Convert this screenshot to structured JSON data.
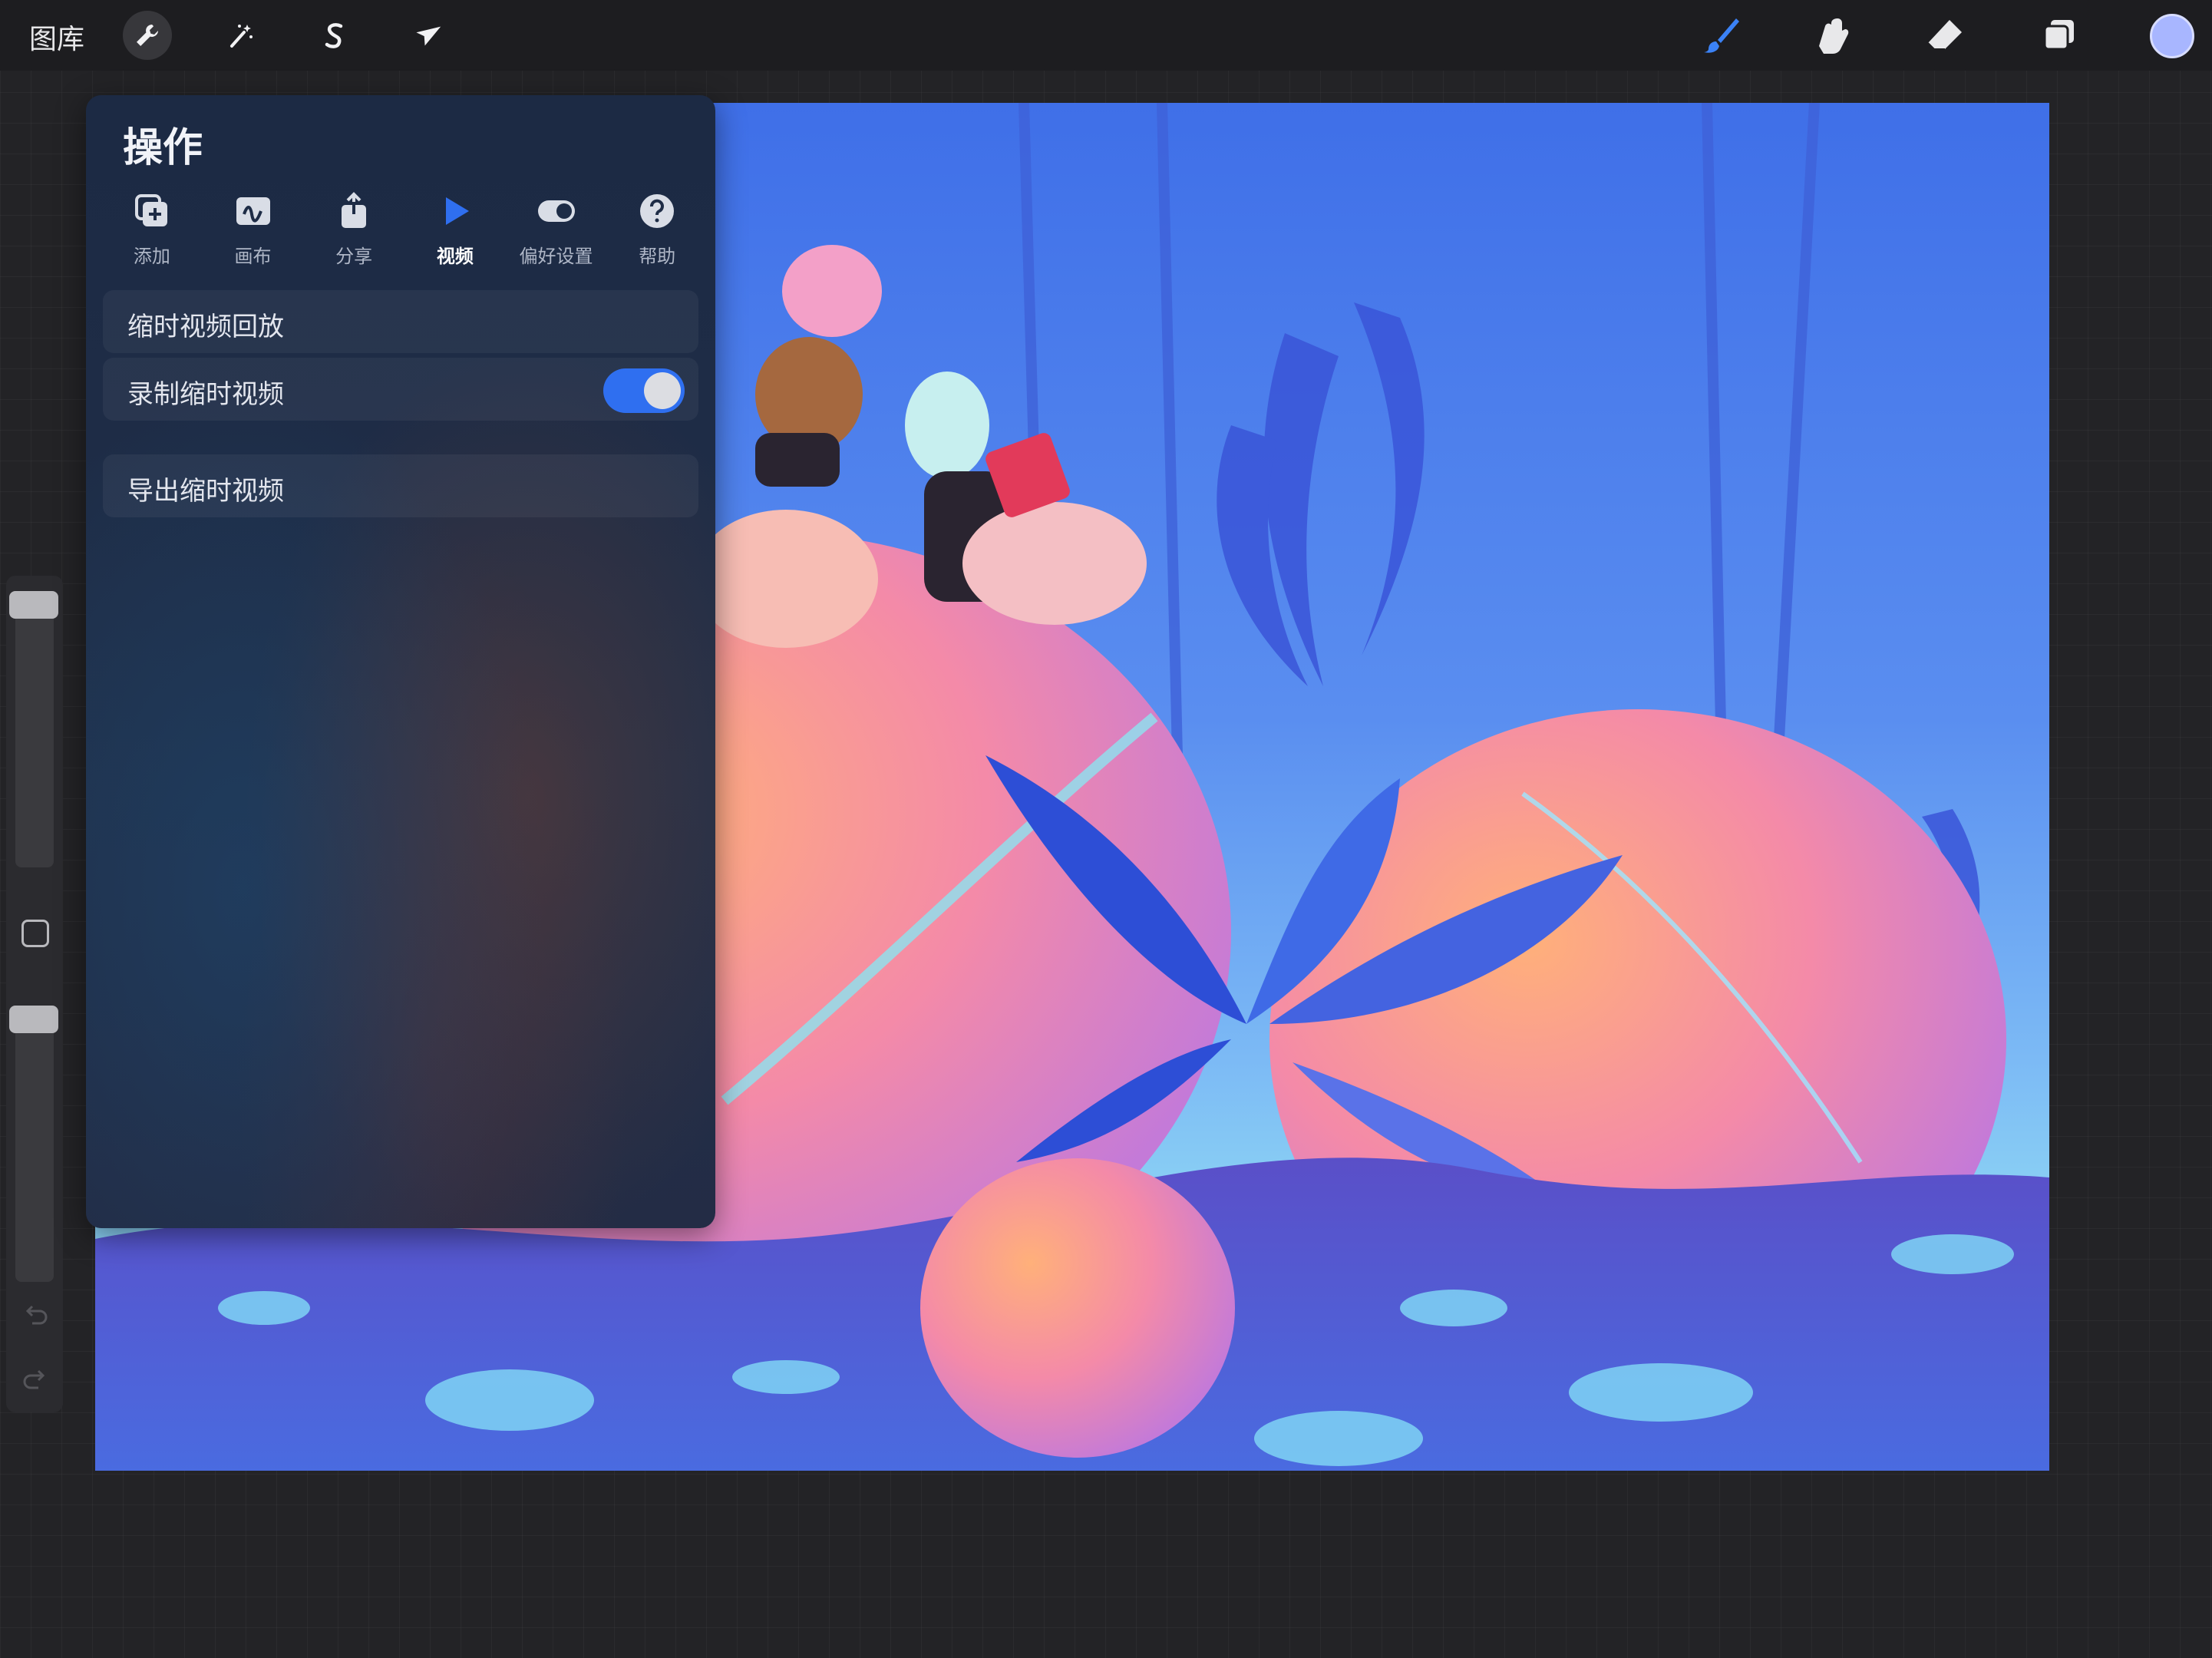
{
  "toolbar": {
    "gallery_label": "图库",
    "left_tools": [
      {
        "name": "actions",
        "icon": "wrench-icon",
        "active": true
      },
      {
        "name": "adjustments",
        "icon": "magic-wand-icon",
        "active": false
      },
      {
        "name": "selection",
        "icon": "selection-s-icon",
        "active": false
      },
      {
        "name": "transform",
        "icon": "arrow-cursor-icon",
        "active": false
      }
    ],
    "right_tools": [
      {
        "name": "brush",
        "icon": "brush-icon",
        "color": "#3b82f6"
      },
      {
        "name": "smudge",
        "icon": "smudge-finger-icon"
      },
      {
        "name": "eraser",
        "icon": "eraser-icon"
      },
      {
        "name": "layers",
        "icon": "layers-icon"
      }
    ],
    "current_color": "#a8b6ff"
  },
  "actions_panel": {
    "title": "操作",
    "tabs": [
      {
        "label": "添加",
        "icon": "add-icon",
        "active": false
      },
      {
        "label": "画布",
        "icon": "canvas-icon",
        "active": false
      },
      {
        "label": "分享",
        "icon": "share-icon",
        "active": false
      },
      {
        "label": "视频",
        "icon": "video-play-icon",
        "active": true
      },
      {
        "label": "偏好设置",
        "icon": "toggle-prefs-icon",
        "active": false
      },
      {
        "label": "帮助",
        "icon": "help-icon",
        "active": false
      }
    ],
    "rows": {
      "timelapse_replay": "缩时视频回放",
      "record_timelapse": "录制缩时视频",
      "record_enabled": true,
      "export_timelapse": "导出缩时视频"
    },
    "accent_color": "#2f6ff0"
  },
  "sidebar": {
    "icons": [
      "modify-square-icon",
      "undo-icon",
      "redo-icon"
    ]
  }
}
